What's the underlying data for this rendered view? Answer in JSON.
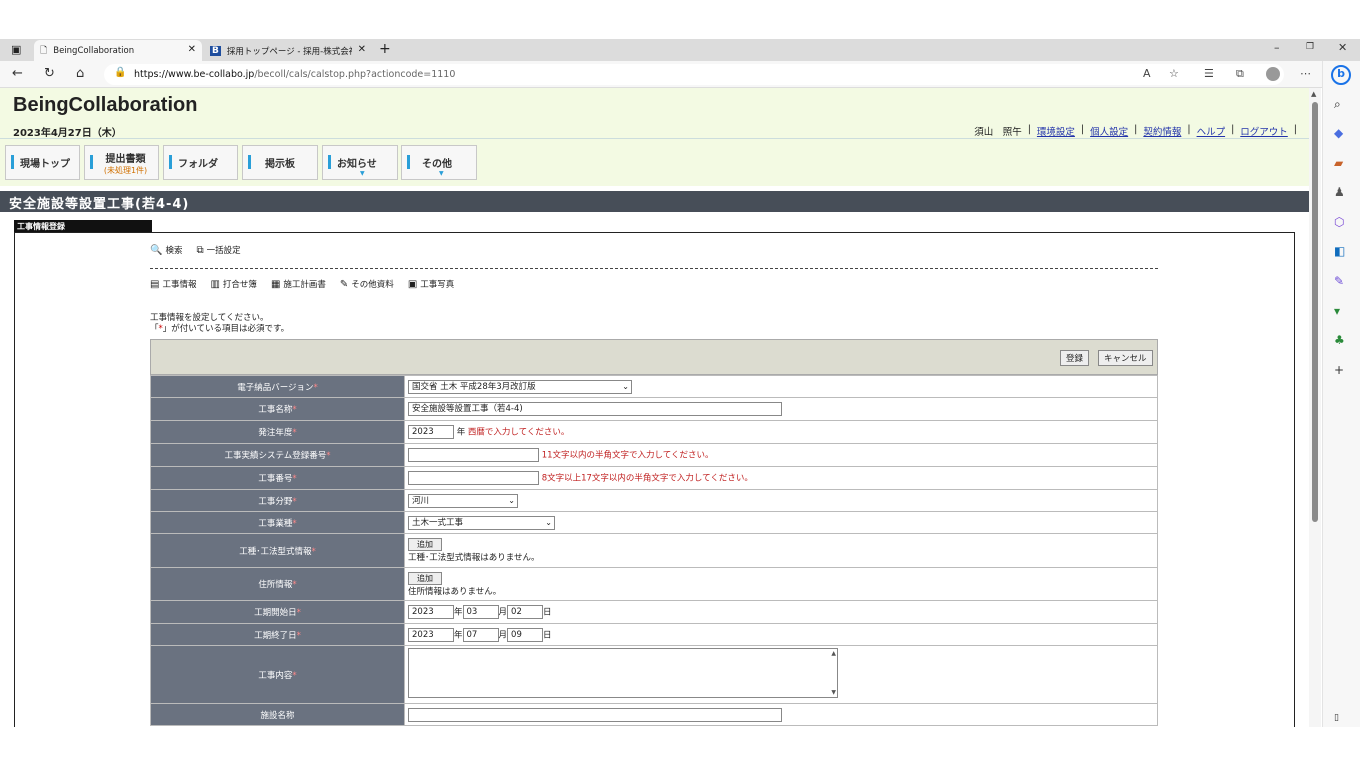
{
  "browser": {
    "tabs": [
      {
        "title": "BeingCollaboration",
        "icon": "page-icon"
      },
      {
        "title": "採用トップページ - 採用-株式会社L",
        "icon": "b-favicon-icon"
      }
    ],
    "url_host": "https://www.be-collabo.jp",
    "url_path": "/becoll/cals/calstop.php?actioncode=1110"
  },
  "header": {
    "logo": "BeingCollaboration",
    "date": "2023年4月27日（木）",
    "user": "須山　照午",
    "links": [
      "環境設定",
      "個人設定",
      "契約情報",
      "ヘルプ",
      "ログアウト"
    ]
  },
  "menu": [
    {
      "label": "現場トップ",
      "sub": ""
    },
    {
      "label": "提出書類",
      "sub": "(未処理1件)"
    },
    {
      "label": "フォルダ",
      "sub": ""
    },
    {
      "label": "掲示板",
      "sub": ""
    },
    {
      "label": "お知らせ",
      "sub": ""
    },
    {
      "label": "その他",
      "sub": ""
    }
  ],
  "page_title": "安全施設等設置工事(若4-4)",
  "section_tab": "工事情報登録",
  "tools1": [
    "検索",
    "一括設定"
  ],
  "tools2": [
    "工事情報",
    "打合せ簿",
    "施工計画書",
    "その他資料",
    "工事写真"
  ],
  "instructions": {
    "line1": "工事情報を設定してください。",
    "line2_pre": "「",
    "line2_mark": "*",
    "line2_post": "」が付いている項目は必須です。"
  },
  "buttons": {
    "register": "登録",
    "cancel": "キャンセル",
    "add": "追加"
  },
  "form": {
    "version_label": "電子納品バージョン",
    "version_value": "国交省 土木 平成28年3月改訂版",
    "name_label": "工事名称",
    "name_value": "安全施設等設置工事（若4-4)",
    "year_label": "発注年度",
    "year_value": "2023",
    "year_unit": "年",
    "year_hint": "西暦で入力してください。",
    "system_label": "工事実績システム登録番号",
    "system_hint": "11文字以内の半角文字で入力してください。",
    "number_label": "工事番号",
    "number_hint": "8文字以上17文字以内の半角文字で入力してください。",
    "field_label": "工事分野",
    "field_value": "河川",
    "type_label": "工事業種",
    "type_value": "土木一式工事",
    "method_label": "工種･工法型式情報",
    "method_none": "工種･工法型式情報はありません。",
    "address_label": "住所情報",
    "address_none": "住所情報はありません。",
    "start_label": "工期開始日",
    "start_y": "2023",
    "start_m": "03",
    "start_d": "02",
    "end_label": "工期終了日",
    "end_y": "2023",
    "end_m": "07",
    "end_d": "09",
    "unit_y": "年",
    "unit_m": "月",
    "unit_d": "日",
    "content_label": "工事内容",
    "facility_label": "施設名称",
    "req": "*"
  }
}
